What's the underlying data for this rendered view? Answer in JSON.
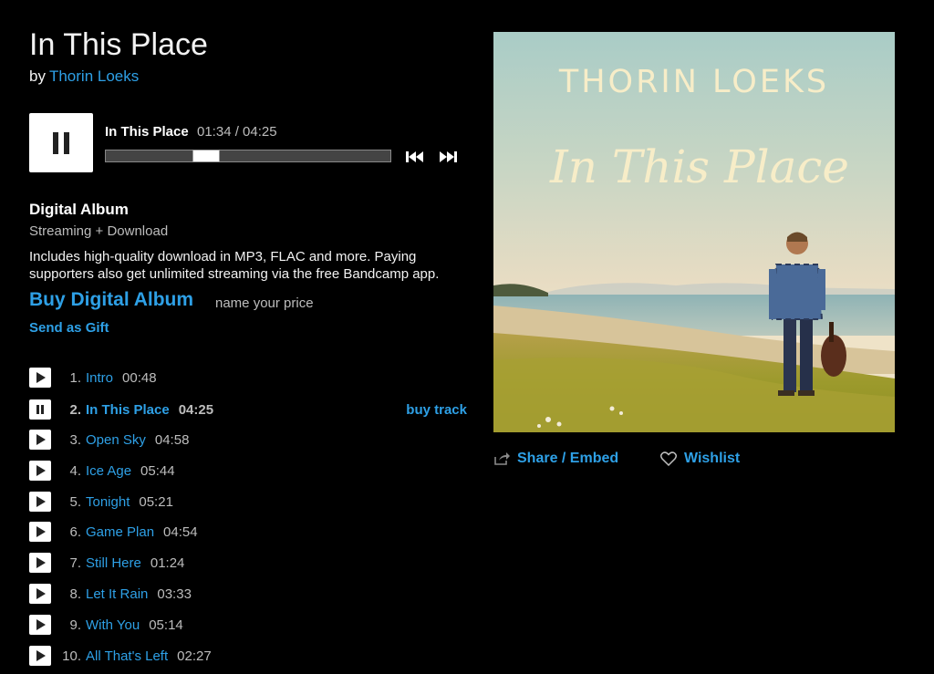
{
  "album": {
    "title": "In This Place",
    "by": "by",
    "artist": "Thorin Loeks"
  },
  "player": {
    "track_title": "In This Place",
    "time": "01:34 / 04:25",
    "progress_fraction": 0.354
  },
  "digital": {
    "title": "Digital Album",
    "subtitle": "Streaming + Download",
    "description": "Includes high-quality download in MP3, FLAC and more. Paying supporters also get unlimited streaming via the free Bandcamp app.",
    "buy_label": "Buy Digital Album",
    "price_note": "name your price",
    "gift_label": "Send as Gift"
  },
  "tracks": [
    {
      "num": "1.",
      "name": "Intro",
      "dur": "00:48"
    },
    {
      "num": "2.",
      "name": "In This Place",
      "dur": "04:25",
      "buy": "buy track"
    },
    {
      "num": "3.",
      "name": "Open Sky",
      "dur": "04:58"
    },
    {
      "num": "4.",
      "name": "Ice Age",
      "dur": "05:44"
    },
    {
      "num": "5.",
      "name": "Tonight",
      "dur": "05:21"
    },
    {
      "num": "6.",
      "name": "Game Plan",
      "dur": "04:54"
    },
    {
      "num": "7.",
      "name": "Still Here",
      "dur": "01:24"
    },
    {
      "num": "8.",
      "name": "Let It Rain",
      "dur": "03:33"
    },
    {
      "num": "9.",
      "name": "With You",
      "dur": "05:14"
    },
    {
      "num": "10.",
      "name": "All That's Left",
      "dur": "02:27"
    }
  ],
  "cover": {
    "artist_text": "THORIN LOEKS",
    "title_text": "In This Place"
  },
  "actions": {
    "share_label": "Share / Embed",
    "wishlist_label": "Wishlist"
  },
  "colors": {
    "accent": "#2ea0e6",
    "background": "#000000"
  }
}
